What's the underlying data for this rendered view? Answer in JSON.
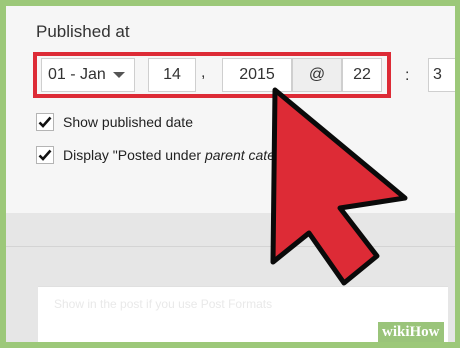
{
  "section": {
    "title": "Published at"
  },
  "date_fields": {
    "month": "01 - Jan",
    "day": "14",
    "comma": ",",
    "year": "2015",
    "at_symbol": "@",
    "hour": "22",
    "colon": ":",
    "minute": "3"
  },
  "options": {
    "show_published_date": {
      "label": "Show published date",
      "checked": true
    },
    "display_posted_under": {
      "label_prefix": "Display \"Posted under ",
      "label_italic": "parent categ",
      "checked": true
    }
  },
  "lower_card": {
    "text": "Show in the post if you use Post Formats"
  },
  "watermark": "wikiHow",
  "colors": {
    "highlight": "#dd2b36",
    "arrow": "#dd2b36",
    "frame": "#9cc879"
  },
  "icons": {
    "checkbox": "checkmark-icon",
    "dropdown": "caret-down-icon",
    "pointer": "arrow-pointer-icon"
  }
}
